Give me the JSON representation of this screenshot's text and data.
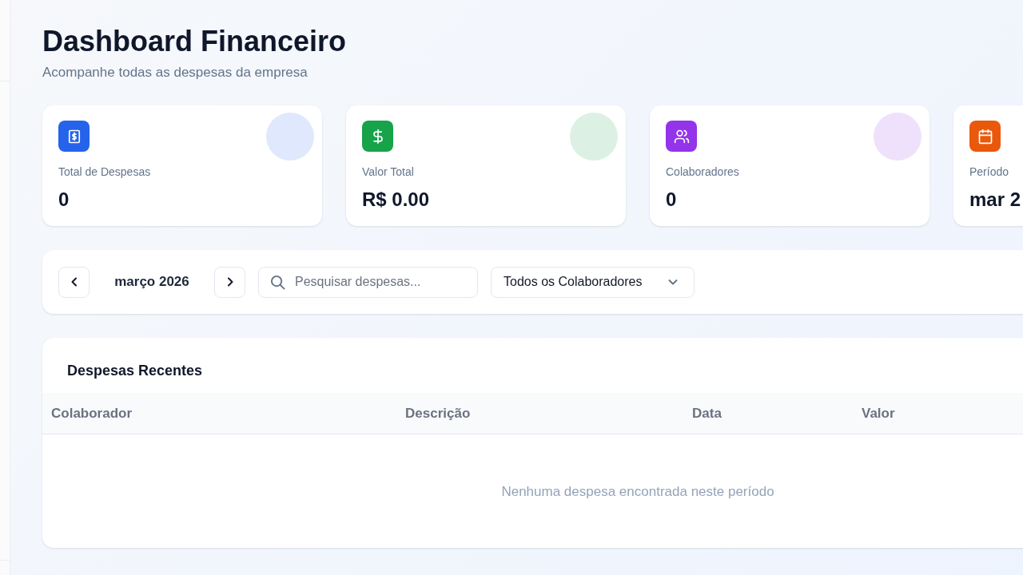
{
  "header": {
    "title": "Dashboard Financeiro",
    "subtitle": "Acompanhe todas as despesas da empresa"
  },
  "stats": [
    {
      "kind": "receipt",
      "color": "#2563eb",
      "label": "Total de Despesas",
      "value": "0"
    },
    {
      "kind": "dollar",
      "color": "#16a34a",
      "label": "Valor Total",
      "value": "R$ 0.00"
    },
    {
      "kind": "users",
      "color": "#9333ea",
      "label": "Colaboradores",
      "value": "0"
    },
    {
      "kind": "calendar",
      "color": "#ea580c",
      "label": "Período",
      "value": "mar 2"
    }
  ],
  "filters": {
    "month": "março 2026",
    "search": {
      "placeholder": "Pesquisar despesas..."
    },
    "collaborator_select": {
      "value": "Todos os Colaboradores"
    }
  },
  "table": {
    "title": "Despesas Recentes",
    "columns": [
      "Colaborador",
      "Descrição",
      "Data",
      "Valor"
    ],
    "empty_message": "Nenhuma despesa encontrada neste período"
  }
}
